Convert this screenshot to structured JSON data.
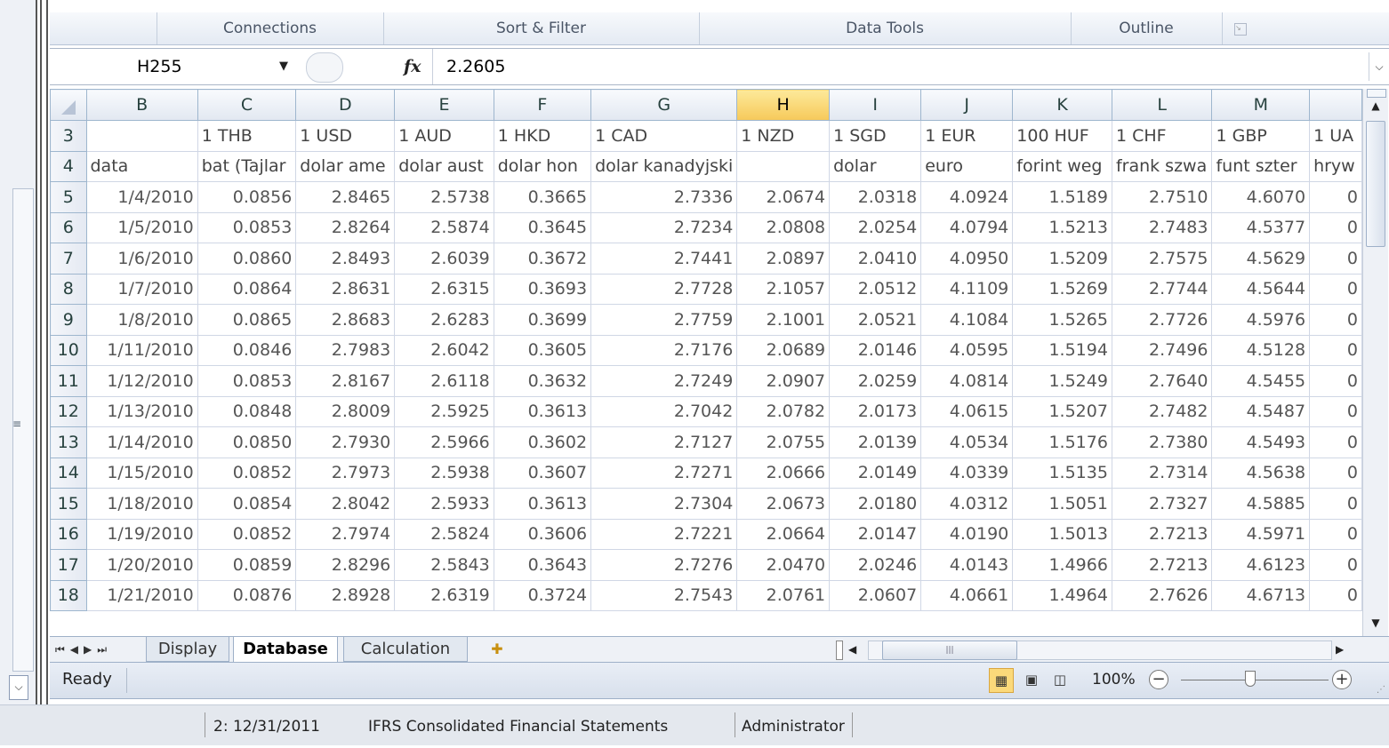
{
  "ribbon": {
    "groups": [
      "Connections",
      "Sort & Filter",
      "Data Tools",
      "Outline"
    ]
  },
  "formula_bar": {
    "name_box": "H255",
    "fx_label": "fx",
    "value": "2.2605"
  },
  "columns": [
    "B",
    "C",
    "D",
    "E",
    "F",
    "G",
    "H",
    "I",
    "J",
    "K",
    "L",
    "M",
    ""
  ],
  "selected_column": "H",
  "rows": [
    {
      "num": "3",
      "cells": [
        "",
        "1 THB",
        "1 USD",
        "1 AUD",
        "1 HKD",
        "1 CAD",
        "1 NZD",
        "1 SGD",
        "1 EUR",
        "100 HUF",
        "1 CHF",
        "1 GBP",
        "1 UA"
      ]
    },
    {
      "num": "4",
      "cells": [
        "data",
        "bat (Tajlar",
        "dolar ame",
        "dolar aust",
        "dolar hon",
        "dolar kanadyjski",
        "",
        "dolar",
        "euro",
        "forint weg",
        "frank szwa",
        "funt szter",
        "hryw"
      ]
    },
    {
      "num": "5",
      "cells": [
        "1/4/2010",
        "0.0856",
        "2.8465",
        "2.5738",
        "0.3665",
        "2.7336",
        "2.0674",
        "2.0318",
        "4.0924",
        "1.5189",
        "2.7510",
        "4.6070",
        "0"
      ]
    },
    {
      "num": "6",
      "cells": [
        "1/5/2010",
        "0.0853",
        "2.8264",
        "2.5874",
        "0.3645",
        "2.7234",
        "2.0808",
        "2.0254",
        "4.0794",
        "1.5213",
        "2.7483",
        "4.5377",
        "0"
      ]
    },
    {
      "num": "7",
      "cells": [
        "1/6/2010",
        "0.0860",
        "2.8493",
        "2.6039",
        "0.3672",
        "2.7441",
        "2.0897",
        "2.0410",
        "4.0950",
        "1.5209",
        "2.7575",
        "4.5629",
        "0"
      ]
    },
    {
      "num": "8",
      "cells": [
        "1/7/2010",
        "0.0864",
        "2.8631",
        "2.6315",
        "0.3693",
        "2.7728",
        "2.1057",
        "2.0512",
        "4.1109",
        "1.5269",
        "2.7744",
        "4.5644",
        "0"
      ]
    },
    {
      "num": "9",
      "cells": [
        "1/8/2010",
        "0.0865",
        "2.8683",
        "2.6283",
        "0.3699",
        "2.7759",
        "2.1001",
        "2.0521",
        "4.1084",
        "1.5265",
        "2.7726",
        "4.5976",
        "0"
      ]
    },
    {
      "num": "10",
      "cells": [
        "1/11/2010",
        "0.0846",
        "2.7983",
        "2.6042",
        "0.3605",
        "2.7176",
        "2.0689",
        "2.0146",
        "4.0595",
        "1.5194",
        "2.7496",
        "4.5128",
        "0"
      ]
    },
    {
      "num": "11",
      "cells": [
        "1/12/2010",
        "0.0853",
        "2.8167",
        "2.6118",
        "0.3632",
        "2.7249",
        "2.0907",
        "2.0259",
        "4.0814",
        "1.5249",
        "2.7640",
        "4.5455",
        "0"
      ]
    },
    {
      "num": "12",
      "cells": [
        "1/13/2010",
        "0.0848",
        "2.8009",
        "2.5925",
        "0.3613",
        "2.7042",
        "2.0782",
        "2.0173",
        "4.0615",
        "1.5207",
        "2.7482",
        "4.5487",
        "0"
      ]
    },
    {
      "num": "13",
      "cells": [
        "1/14/2010",
        "0.0850",
        "2.7930",
        "2.5966",
        "0.3602",
        "2.7127",
        "2.0755",
        "2.0139",
        "4.0534",
        "1.5176",
        "2.7380",
        "4.5493",
        "0"
      ]
    },
    {
      "num": "14",
      "cells": [
        "1/15/2010",
        "0.0852",
        "2.7973",
        "2.5938",
        "0.3607",
        "2.7271",
        "2.0666",
        "2.0149",
        "4.0339",
        "1.5135",
        "2.7314",
        "4.5638",
        "0"
      ]
    },
    {
      "num": "15",
      "cells": [
        "1/18/2010",
        "0.0854",
        "2.8042",
        "2.5933",
        "0.3613",
        "2.7304",
        "2.0673",
        "2.0180",
        "4.0312",
        "1.5051",
        "2.7327",
        "4.5885",
        "0"
      ]
    },
    {
      "num": "16",
      "cells": [
        "1/19/2010",
        "0.0852",
        "2.7974",
        "2.5824",
        "0.3606",
        "2.7221",
        "2.0664",
        "2.0147",
        "4.0190",
        "1.5013",
        "2.7213",
        "4.5971",
        "0"
      ]
    },
    {
      "num": "17",
      "cells": [
        "1/20/2010",
        "0.0859",
        "2.8296",
        "2.5843",
        "0.3643",
        "2.7276",
        "2.0470",
        "2.0246",
        "4.0143",
        "1.4966",
        "2.7213",
        "4.6123",
        "0"
      ]
    },
    {
      "num": "18",
      "cells": [
        "1/21/2010",
        "0.0876",
        "2.8928",
        "2.6319",
        "0.3724",
        "2.7543",
        "2.0761",
        "2.0607",
        "4.0661",
        "1.4964",
        "2.7626",
        "4.6713",
        "0"
      ]
    }
  ],
  "sheet_tabs": [
    {
      "label": "Display",
      "active": false
    },
    {
      "label": "Database",
      "active": true
    },
    {
      "label": "Calculation",
      "active": false
    }
  ],
  "status": {
    "ready": "Ready",
    "zoom": "100%"
  },
  "taskbar": {
    "date": "2: 12/31/2011",
    "title": "IFRS Consolidated Financial Statements",
    "user": "Administrator"
  },
  "icons": [
    "name-box-dropdown-icon",
    "fx-icon",
    "expand-formula-icon",
    "sheet-nav-icons",
    "insert-sheet-icon",
    "normal-view-icon",
    "page-layout-icon",
    "page-break-icon",
    "zoom-out-icon",
    "zoom-in-icon"
  ]
}
